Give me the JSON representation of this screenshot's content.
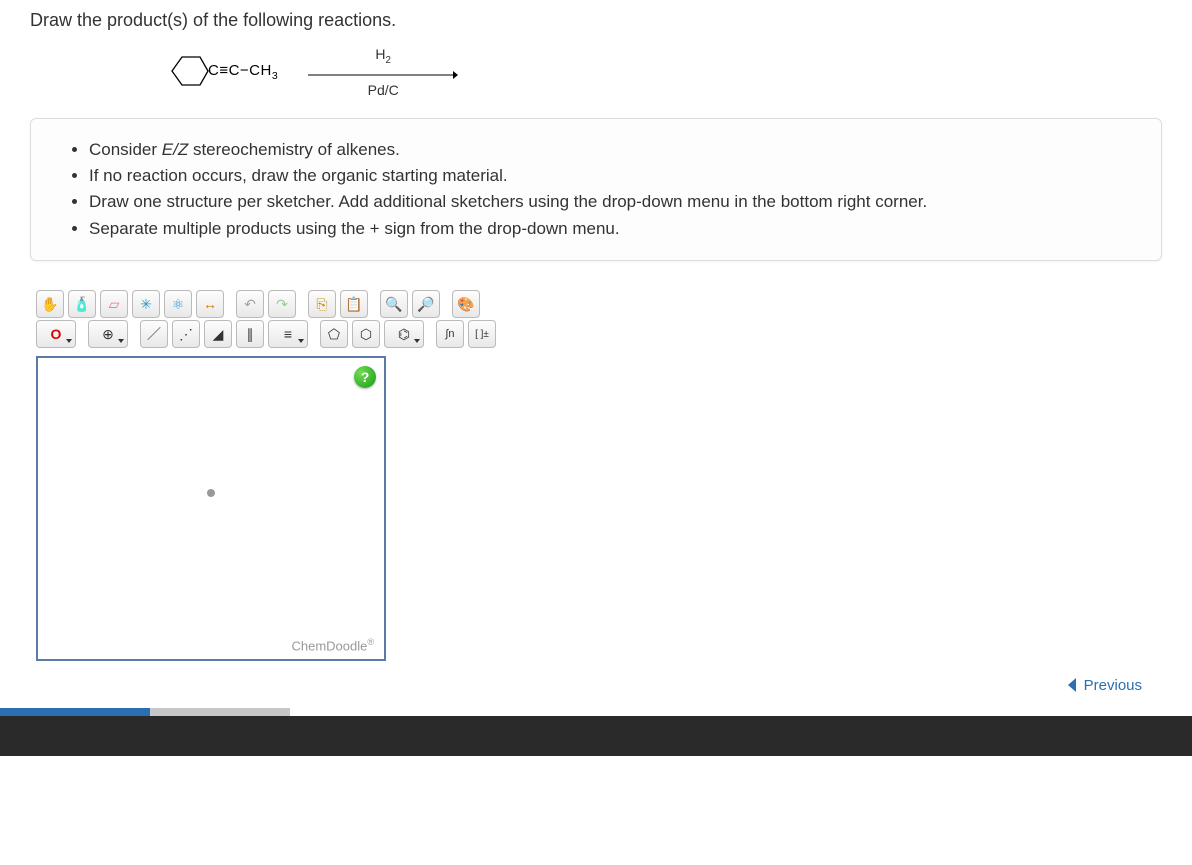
{
  "question": {
    "title": "Draw the product(s) of the following reactions.",
    "reaction": {
      "reactant_formula": "C≡C−CH",
      "reactant_sub": "3",
      "reagent_top": "H",
      "reagent_top_sub": "2",
      "reagent_bottom": "Pd/C"
    }
  },
  "instructions": {
    "items": [
      "Consider <em>E/Z</em> stereochemistry of alkenes.",
      "If no reaction occurs, draw the organic starting material.",
      "Draw one structure per sketcher. Add additional sketchers using the drop-down menu in the bottom right corner.",
      "Separate multiple products using the + sign from the drop-down menu."
    ]
  },
  "sketcher": {
    "atom_label": "O",
    "brand": "ChemDoodle",
    "brand_mark": "®",
    "help": "?"
  },
  "nav": {
    "previous": "Previous"
  },
  "icons": {
    "hand": "✋",
    "spray": "🧴",
    "eraser": "▱",
    "center": "✳",
    "clean": "⚛",
    "flip": "↔",
    "undo": "↶",
    "redo": "↷",
    "copy": "⎘",
    "paste": "📋",
    "zoom_in": "🔍",
    "zoom_out": "🔎",
    "color": "🎨",
    "charge": "⊕",
    "bond_single": "／",
    "bond_dash": "⋰",
    "bond_wedge": "◢",
    "bond_double": "∥",
    "bond_triple": "≡",
    "ring5": "⬠",
    "ring6": "⬡",
    "ring_benzene": "⌬",
    "integral_n": "∫n",
    "bracket": "[ ]±"
  }
}
